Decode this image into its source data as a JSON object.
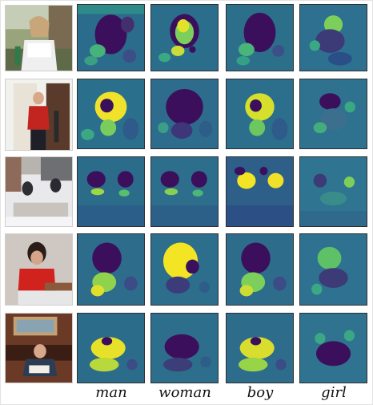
{
  "columns": [
    {
      "key": "man",
      "label": "man"
    },
    {
      "key": "woman",
      "label": "woman"
    },
    {
      "key": "boy",
      "label": "boy"
    },
    {
      "key": "girl",
      "label": "girl"
    }
  ],
  "rows": [
    {
      "scene": "woman-reading-outdoors",
      "highlighted_column": "woman"
    },
    {
      "scene": "man-red-shirt-in-doorway",
      "highlighted_column": "man"
    },
    {
      "scene": "two-boys-in-snow",
      "highlighted_column": "boy"
    },
    {
      "scene": "girl-red-shirt-leaning",
      "highlighted_column": "woman"
    },
    {
      "scene": "man-reading-at-piano",
      "highlighted_column": "man"
    }
  ],
  "colormap": {
    "name": "viridis",
    "low": "#3b0f5c",
    "mid": "#2a8a86",
    "high": "#f2e524"
  }
}
